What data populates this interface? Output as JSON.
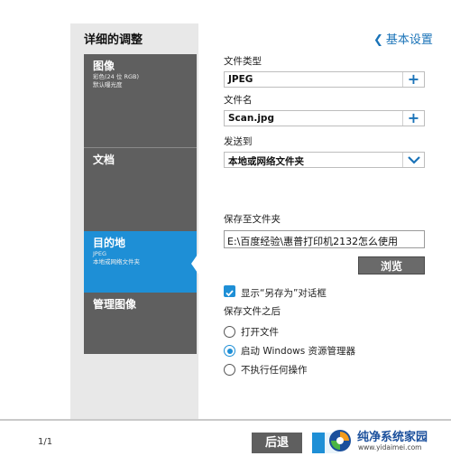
{
  "header": {
    "title": "详细的调整",
    "back_label": "基本设置"
  },
  "nav": {
    "items": [
      {
        "title": "图像",
        "sub1": "彩色(24 位 RGB)",
        "sub2": "默认曝光度"
      },
      {
        "title": "文档"
      },
      {
        "title": "目的地",
        "sub1": "JPEG",
        "sub2": "本地或网络文件夹",
        "active": true
      },
      {
        "title": "管理图像"
      }
    ]
  },
  "form": {
    "file_type_label": "文件类型",
    "file_type_value": "JPEG",
    "file_name_label": "文件名",
    "file_name_value": "Scan.jpg",
    "send_to_label": "发送到",
    "send_to_value": "本地或网络文件夹",
    "save_folder_label": "保存至文件夹",
    "save_folder_value": "E:\\百度经验\\惠普打印机2132怎么使用",
    "browse_label": "浏览",
    "show_save_as_label": "显示“另存为”对话框",
    "show_save_as_checked": true,
    "after_save_label": "保存文件之后",
    "after_options": [
      {
        "label": "打开文件",
        "selected": false
      },
      {
        "label": "启动 Windows 资源管理器",
        "selected": true
      },
      {
        "label": "不执行任何操作",
        "selected": false
      }
    ]
  },
  "footer": {
    "page_count": "1/1",
    "back_button": "后退"
  },
  "watermark": {
    "title": "纯净系统家园",
    "url": "www.yidaimei.com"
  },
  "colors": {
    "accent": "#1e8fd6",
    "nav_bg": "#5f5f5f",
    "link": "#1a73b8"
  },
  "icons": {
    "plus": "plus-icon",
    "dropdown": "chevron-down-icon",
    "back": "chevron-left-icon",
    "check": "checkmark-icon"
  }
}
